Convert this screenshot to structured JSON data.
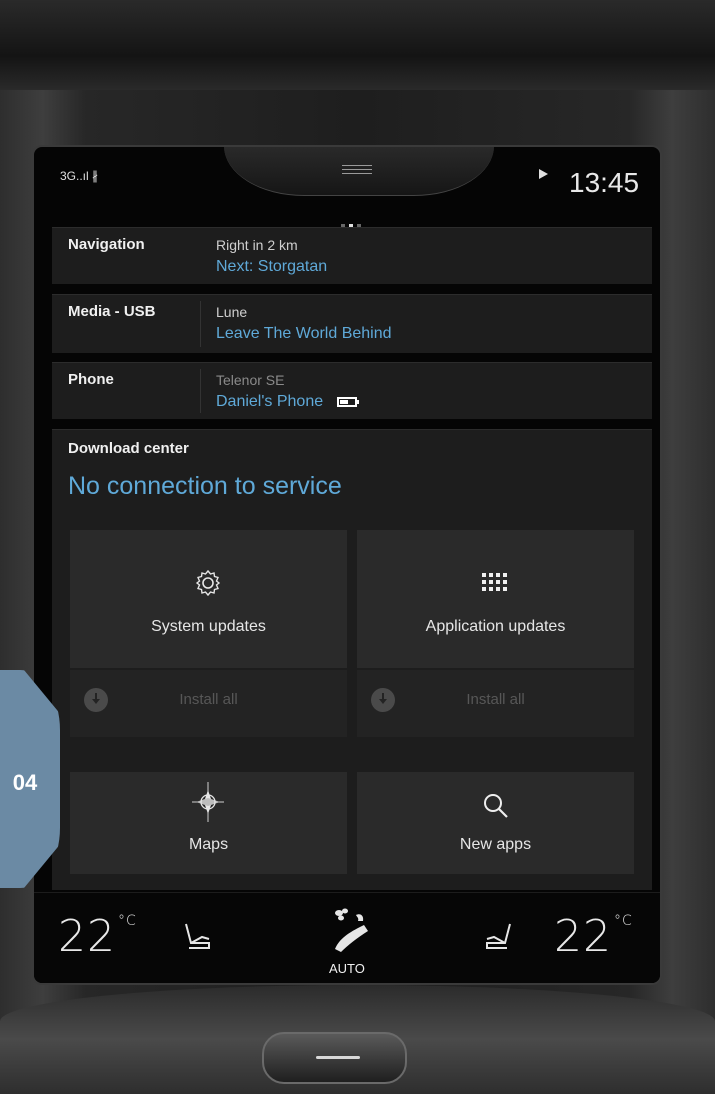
{
  "status_bar": {
    "signal": "3G..ıl ∦",
    "time": "13:45"
  },
  "tiles": {
    "navigation": {
      "label": "Navigation",
      "line1": "Right in 2 km",
      "line2": "Next: Storgatan"
    },
    "media": {
      "label": "Media - USB",
      "line1": "Lune",
      "line2": "Leave The World Behind"
    },
    "phone": {
      "label": "Phone",
      "line1": "Telenor SE",
      "line2": "Daniel's Phone"
    }
  },
  "download_center": {
    "title": "Download center",
    "status": "No connection to service",
    "system_updates": "System updates",
    "application_updates": "Application updates",
    "install_all_system": "Install all",
    "install_all_apps": "Install all",
    "maps": "Maps",
    "new_apps": "New apps"
  },
  "climate": {
    "left_temp": "22",
    "right_temp": "22",
    "unit": "°C",
    "fan_mode": "AUTO"
  },
  "chapter_tab": "04",
  "colors": {
    "accent_blue": "#5fa9d8",
    "tile_bg": "#1d1d1d",
    "card_bg": "#2a2a2a",
    "chapter_tab": "#6b8aa4"
  },
  "icons": [
    "gear-icon",
    "grid-icon",
    "compass-icon",
    "search-icon",
    "download-icon",
    "seat-icon",
    "fan-icon",
    "battery-icon",
    "play-icon"
  ]
}
